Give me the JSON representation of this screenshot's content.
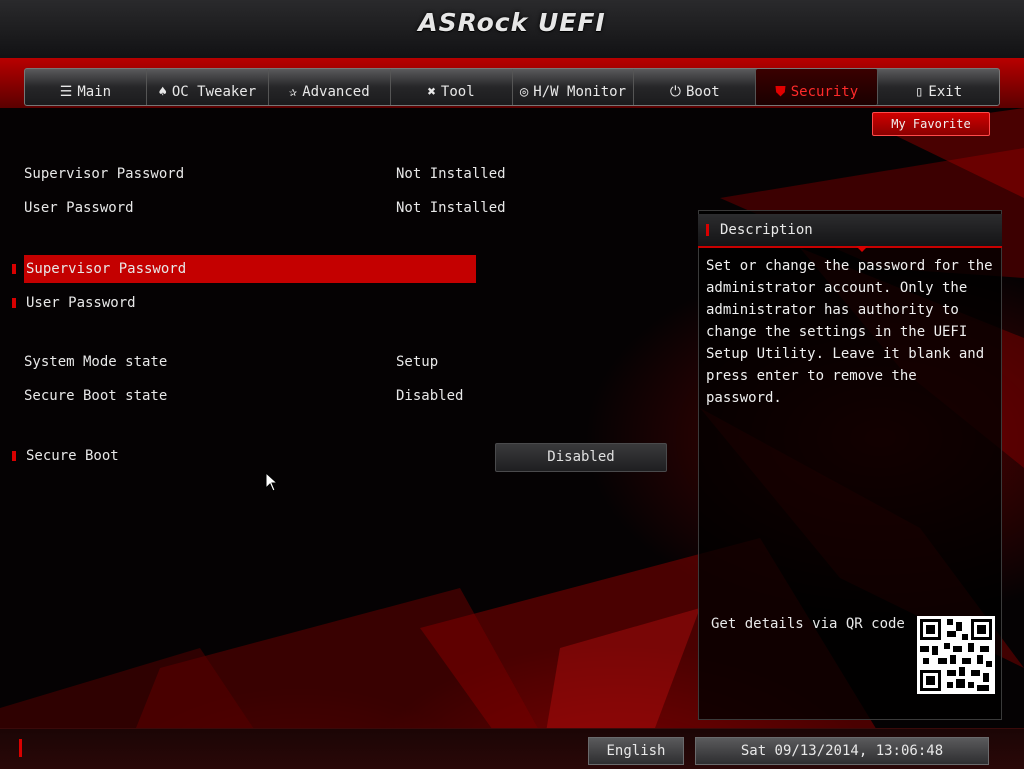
{
  "header": {
    "logo": "ASRock UEFI"
  },
  "tabs": [
    {
      "label": "Main",
      "icon": "list-icon",
      "glyph": "☰"
    },
    {
      "label": "OC Tweaker",
      "icon": "rocket-icon",
      "glyph": "♠"
    },
    {
      "label": "Advanced",
      "icon": "star-icon",
      "glyph": "✰"
    },
    {
      "label": "Tool",
      "icon": "tools-icon",
      "glyph": "✖"
    },
    {
      "label": "H/W Monitor",
      "icon": "monitor-icon",
      "glyph": "◎"
    },
    {
      "label": "Boot",
      "icon": "power-icon",
      "glyph": "⏻"
    },
    {
      "label": "Security",
      "icon": "shield-icon",
      "glyph": "⛊"
    },
    {
      "label": "Exit",
      "icon": "exit-icon",
      "glyph": "▯"
    }
  ],
  "favorite_label": "My Favorite",
  "settings": {
    "supervisor_password_status": {
      "label": "Supervisor Password",
      "value": "Not Installed"
    },
    "user_password_status": {
      "label": "User Password",
      "value": "Not Installed"
    },
    "supervisor_password_item": {
      "label": "Supervisor Password"
    },
    "user_password_item": {
      "label": "User Password"
    },
    "system_mode": {
      "label": "System Mode state",
      "value": "Setup"
    },
    "secure_boot_state": {
      "label": "Secure Boot state",
      "value": "Disabled"
    },
    "secure_boot": {
      "label": "Secure Boot",
      "value": "Disabled"
    }
  },
  "description": {
    "title": "Description",
    "text": "Set or change the password for the administrator account. Only the administrator has authority to change the settings in the UEFI Setup Utility. Leave it blank and press enter to remove the password.",
    "qr_label": "Get details via QR code"
  },
  "footer": {
    "language": "English",
    "datetime": "Sat 09/13/2014, 13:06:48"
  },
  "colors": {
    "accent": "#d80000",
    "active_tab_text": "#ff2a2a"
  }
}
